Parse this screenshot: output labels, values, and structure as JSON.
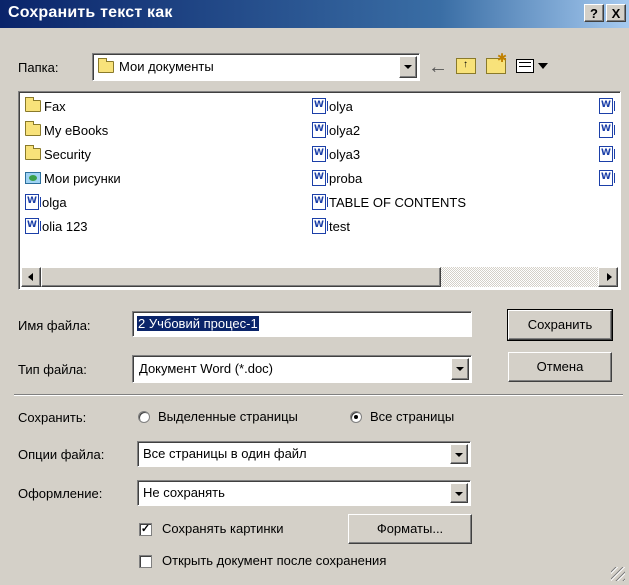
{
  "window": {
    "title": "Сохранить текст как",
    "help_btn": "?",
    "close_btn": "X"
  },
  "toolbar": {
    "folder_label": "Папка:",
    "folder_value": "Мои документы"
  },
  "files": {
    "col1": [
      {
        "name": "Fax",
        "icon": "folder-icon"
      },
      {
        "name": "My eBooks",
        "icon": "folder-icon"
      },
      {
        "name": "Security",
        "icon": "folder-icon"
      },
      {
        "name": "Мои рисунки",
        "icon": "pictures-folder-icon"
      },
      {
        "name": "olga",
        "icon": "word-doc-icon"
      },
      {
        "name": "olia 123",
        "icon": "word-doc-icon"
      }
    ],
    "col2": [
      {
        "name": "olya",
        "icon": "word-doc-icon"
      },
      {
        "name": "olya2",
        "icon": "word-doc-icon"
      },
      {
        "name": "olya3",
        "icon": "word-doc-icon"
      },
      {
        "name": "proba",
        "icon": "word-doc-icon"
      },
      {
        "name": "TABLE OF CONTENTS",
        "icon": "word-doc-icon"
      },
      {
        "name": "test",
        "icon": "word-doc-icon"
      }
    ]
  },
  "form": {
    "filename_label": "Имя файла:",
    "filename_value": "2 Учбовий процес-1",
    "filetype_label": "Тип файла:",
    "filetype_value": "Документ Word (*.doc)",
    "save_button": "Сохранить",
    "cancel_button": "Отмена",
    "save_label": "Сохранить:",
    "radio_selected_pages": "Выделенные страницы",
    "radio_all_pages": "Все страницы",
    "file_options_label": "Опции файла:",
    "file_options_value": "Все страницы в один файл",
    "formatting_label": "Оформление:",
    "formatting_value": "Не сохранять",
    "save_pictures_label": "Сохранять картинки",
    "formats_button": "Форматы...",
    "open_after_label": "Открыть документ после сохранения"
  },
  "colors": {
    "title_start": "#0a246a",
    "title_end": "#a6caf0",
    "dialog_bg": "#d4d0c8",
    "selection": "#0a246a"
  }
}
